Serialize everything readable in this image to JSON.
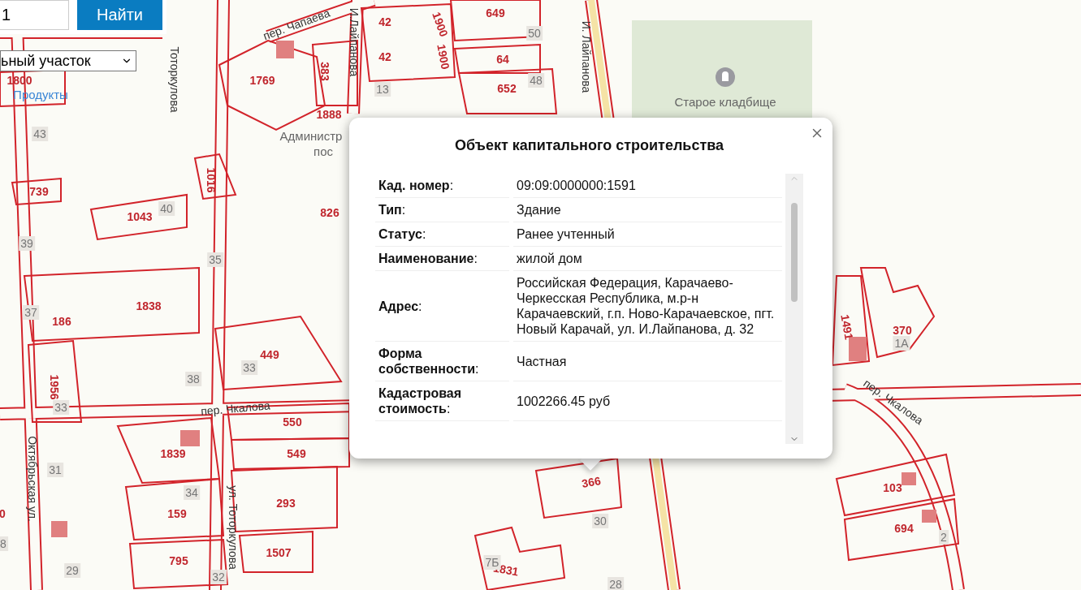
{
  "search": {
    "value": "1",
    "button": "Найти",
    "layer": "ьный участок"
  },
  "map": {
    "parcels": [
      "1800",
      "1769",
      "383",
      "1888",
      "1016",
      "826",
      "739",
      "1043",
      "1838",
      "186",
      "1956",
      "449",
      "550",
      "549",
      "1839",
      "293",
      "159",
      "1507",
      "795",
      "42",
      "42",
      "1900",
      "1900",
      "649",
      "64",
      "652",
      "1491",
      "370",
      "103",
      "694",
      "366",
      "1831",
      "0"
    ],
    "houses": [
      "43",
      "40",
      "39",
      "35",
      "37",
      "38",
      "33",
      "33",
      "31",
      "34",
      "29",
      "32",
      "13",
      "50",
      "48",
      "30",
      "28",
      "7Б",
      "1А",
      "2",
      "8"
    ],
    "streets": [
      "пер. Чапаева",
      "И.Лайпанова",
      "Тоторкулова",
      "И. Лайпанова",
      "пер. Чкалова",
      "Октябрьская ул.",
      "ул. Тоторкулова",
      "пер. Чкалова"
    ],
    "places": [
      {
        "kind": "cemetery",
        "label": "Старое кладбище"
      },
      {
        "kind": "shop",
        "label": "Продукты"
      },
      {
        "kind": "office",
        "label": "Администр"
      },
      {
        "kind": "office",
        "label": "пос"
      }
    ]
  },
  "popup": {
    "title": "Объект капитального строительства",
    "rows": [
      {
        "label": "**Кад. номер**:",
        "value": "09:09:0000000:1591"
      },
      {
        "label": "**Тип**:",
        "value": "Здание"
      },
      {
        "label": "**Статус**:",
        "value": "Ранее учтенный"
      },
      {
        "label": "**Наименование**:",
        "value": "жилой дом"
      },
      {
        "label": "**Адрес**:",
        "value": "Российская Федерация, Карачаево-Черкесская Республика, м.р-н Карачаевский, г.п. Ново-Карачаевское, пгт. Новый Карачай, ул. И.Лайпанова, д. 32"
      },
      {
        "label": "**Форма собственности**:",
        "value": "Частная"
      },
      {
        "label": "**Кадастровая стоимость**:",
        "value": "1002266.45 руб"
      }
    ]
  }
}
